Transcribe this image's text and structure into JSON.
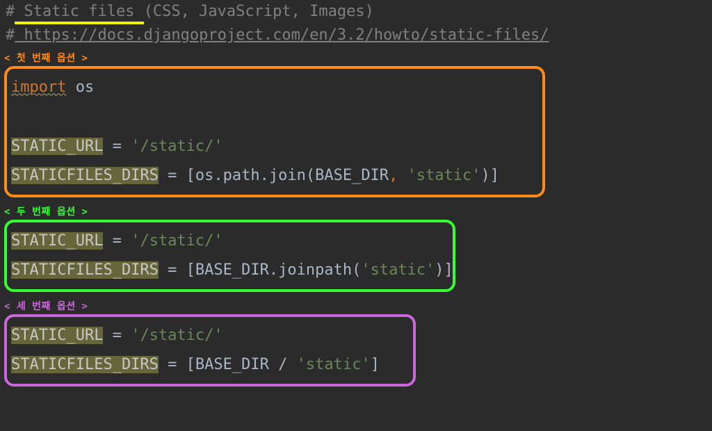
{
  "header": {
    "comment1_hash": "#",
    "comment1_hl": " Static files ",
    "comment1_rest": "(CSS, JavaScript, Images)",
    "comment2_hash": "#",
    "comment2_url": " https://docs.djangoproject.com/en/3.2/howto/static-files/"
  },
  "option1": {
    "label": "< 첫 번째 옵션 >",
    "import_kw": "import",
    "import_module": " os",
    "line2_var": "STATIC_URL",
    "line2_mid": " = ",
    "line2_str": "'/static/'",
    "line3_var": "STATICFILES_DIRS",
    "line3_mid": " = [os.path.join(BASE_DIR",
    "line3_comma": ", ",
    "line3_str": "'static'",
    "line3_end": ")]"
  },
  "option2": {
    "label": "< 두 번째 옵션 >",
    "line1_var": "STATIC_URL",
    "line1_mid": " = ",
    "line1_str": "'/static/'",
    "line2_var": "STATICFILES_DIRS",
    "line2_mid": " = [BASE_DIR.joinpath(",
    "line2_str": "'static'",
    "line2_end": ")]"
  },
  "option3": {
    "label": "< 세 번째 옵션 >",
    "line1_var": "STATIC_URL",
    "line1_mid": " = ",
    "line1_str": "'/static/'",
    "line2_var": "STATICFILES_DIRS",
    "line2_mid": " = [BASE_DIR / ",
    "line2_str": "'static'",
    "line2_end": "]"
  }
}
